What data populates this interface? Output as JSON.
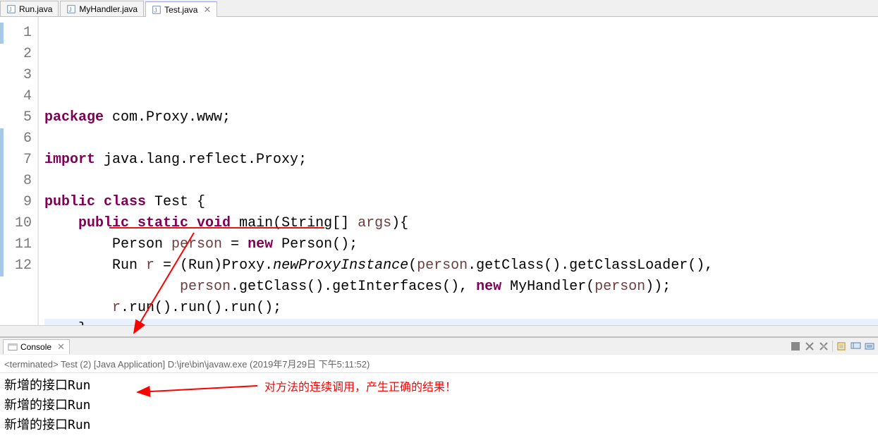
{
  "tabs": [
    {
      "label": "Run.java",
      "active": false
    },
    {
      "label": "MyHandler.java",
      "active": false
    },
    {
      "label": "Test.java",
      "active": true
    }
  ],
  "code": {
    "lines": [
      {
        "num": "1",
        "tokens": [
          [
            "kw",
            "package"
          ],
          [
            "plain",
            " com.Proxy.www;"
          ]
        ]
      },
      {
        "num": "2",
        "tokens": []
      },
      {
        "num": "3",
        "tokens": [
          [
            "kw",
            "import"
          ],
          [
            "plain",
            " java.lang.reflect.Proxy;"
          ]
        ]
      },
      {
        "num": "4",
        "tokens": []
      },
      {
        "num": "5",
        "tokens": [
          [
            "kw",
            "public class"
          ],
          [
            "plain",
            " Test {"
          ]
        ]
      },
      {
        "num": "6",
        "tokens": [
          [
            "plain",
            "    "
          ],
          [
            "kw",
            "public static void"
          ],
          [
            "plain",
            " main(String[] "
          ],
          [
            "var",
            "args"
          ],
          [
            "plain",
            "){"
          ]
        ],
        "triangle": true
      },
      {
        "num": "7",
        "tokens": [
          [
            "plain",
            "        Person "
          ],
          [
            "var",
            "person"
          ],
          [
            "plain",
            " = "
          ],
          [
            "kw",
            "new"
          ],
          [
            "plain",
            " Person();"
          ]
        ]
      },
      {
        "num": "8",
        "tokens": [
          [
            "plain",
            "        Run "
          ],
          [
            "var",
            "r"
          ],
          [
            "plain",
            " = (Run)Proxy."
          ],
          [
            "method-static",
            "newProxyInstance"
          ],
          [
            "plain",
            "("
          ],
          [
            "var",
            "person"
          ],
          [
            "plain",
            ".getClass().getClassLoader(),"
          ]
        ]
      },
      {
        "num": "9",
        "tokens": [
          [
            "plain",
            "                "
          ],
          [
            "var",
            "person"
          ],
          [
            "plain",
            ".getClass().getInterfaces(), "
          ],
          [
            "kw",
            "new"
          ],
          [
            "plain",
            " MyHandler("
          ],
          [
            "var",
            "person"
          ],
          [
            "plain",
            "));"
          ]
        ]
      },
      {
        "num": "10",
        "tokens": [
          [
            "plain",
            "        "
          ],
          [
            "var",
            "r"
          ],
          [
            "plain",
            ".run().run().run();"
          ]
        ]
      },
      {
        "num": "11",
        "tokens": [
          [
            "plain",
            "    }"
          ]
        ],
        "highlighted": true
      },
      {
        "num": "12",
        "tokens": [
          [
            "plain",
            "}"
          ]
        ]
      }
    ]
  },
  "console": {
    "tab_label": "Console",
    "status": "<terminated> Test (2) [Java Application] D:\\jre\\bin\\javaw.exe (2019年7月29日 下午5:11:52)",
    "output": [
      "新增的接口Run",
      "新增的接口Run",
      "新增的接口Run"
    ]
  },
  "annotation": {
    "text": "对方法的连续调用，产生正确的结果！"
  }
}
